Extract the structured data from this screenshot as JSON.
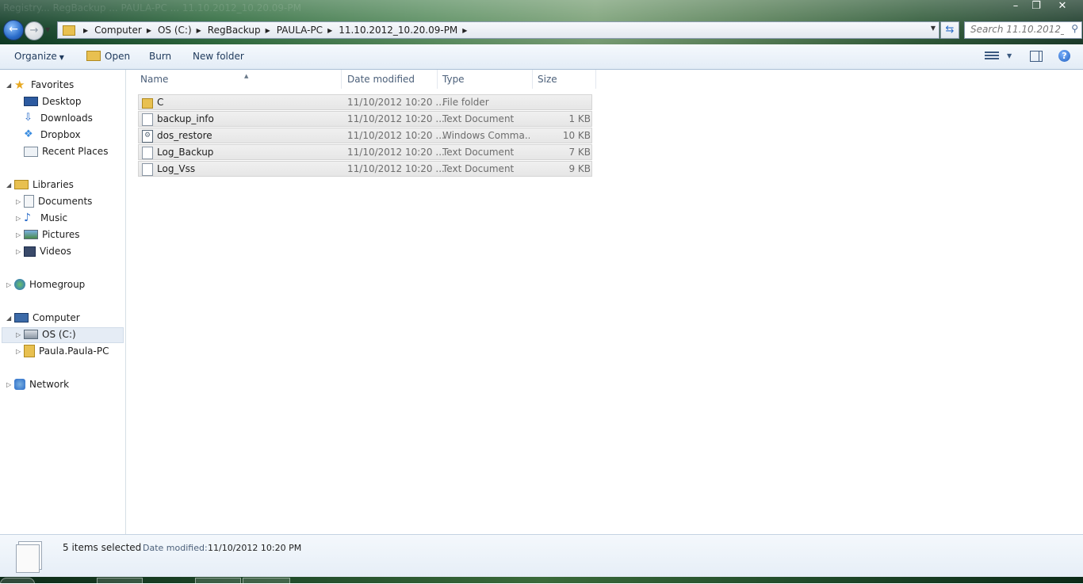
{
  "window": {
    "faded_title": "Registry... RegBackup ... PAULA-PC ... 11.10.2012_10.20.09-PM"
  },
  "address": {
    "crumbs": [
      "Computer",
      "OS (C:)",
      "RegBackup",
      "PAULA-PC",
      "11.10.2012_10.20.09-PM"
    ],
    "search_placeholder": "Search 11.10.2012_1..."
  },
  "toolbar": {
    "organize_label": "Organize",
    "open_label": "Open",
    "burn_label": "Burn",
    "new_folder_label": "New folder"
  },
  "navpane": {
    "favorites": "Favorites",
    "favorites_items": [
      "Desktop",
      "Downloads",
      "Dropbox",
      "Recent Places"
    ],
    "libraries": "Libraries",
    "libraries_items": [
      "Documents",
      "Music",
      "Pictures",
      "Videos"
    ],
    "homegroup": "Homegroup",
    "computer": "Computer",
    "computer_items": [
      "OS (C:)",
      "Paula.Paula-PC"
    ],
    "network": "Network"
  },
  "columns": {
    "name": "Name",
    "date": "Date modified",
    "type": "Type",
    "size": "Size"
  },
  "files": [
    {
      "name": "C",
      "date": "11/10/2012 10:20 ...",
      "type": "File folder",
      "size": "",
      "icon": "folder-icon"
    },
    {
      "name": "backup_info",
      "date": "11/10/2012 10:20 ...",
      "type": "Text Document",
      "size": "1 KB",
      "icon": "text-document-icon"
    },
    {
      "name": "dos_restore",
      "date": "11/10/2012 10:20 ...",
      "type": "Windows Comma...",
      "size": "10 KB",
      "icon": "batch-file-icon"
    },
    {
      "name": "Log_Backup",
      "date": "11/10/2012 10:20 ...",
      "type": "Text Document",
      "size": "7 KB",
      "icon": "text-document-icon"
    },
    {
      "name": "Log_Vss",
      "date": "11/10/2012 10:20 ...",
      "type": "Text Document",
      "size": "9 KB",
      "icon": "text-document-icon"
    }
  ],
  "status": {
    "selected_count": "5 items selected",
    "date_label": "Date modified:",
    "date_value": "11/10/2012 10:20 PM"
  }
}
